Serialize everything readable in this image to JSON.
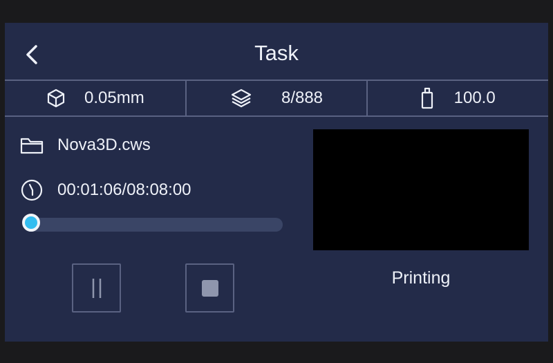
{
  "header": {
    "title": "Task"
  },
  "stats": {
    "layer_thickness": "0.05mm",
    "layers": "8/888",
    "resin": "100.0"
  },
  "file": {
    "name": "Nova3D.cws"
  },
  "time": {
    "elapsed_total": "00:01:06/08:08:00"
  },
  "progress": {
    "fraction": 0.0
  },
  "status": {
    "text": "Printing"
  },
  "icons": {
    "back": "chevron-left-icon",
    "thickness": "cube-icon",
    "layers": "layers-icon",
    "resin": "bottle-icon",
    "file": "folder-icon",
    "time": "clock-icon",
    "pause": "pause-icon",
    "stop": "stop-icon"
  },
  "colors": {
    "background": "#232b49",
    "accent": "#33bdf0",
    "divider": "#5a6282",
    "preview": "#000000"
  }
}
